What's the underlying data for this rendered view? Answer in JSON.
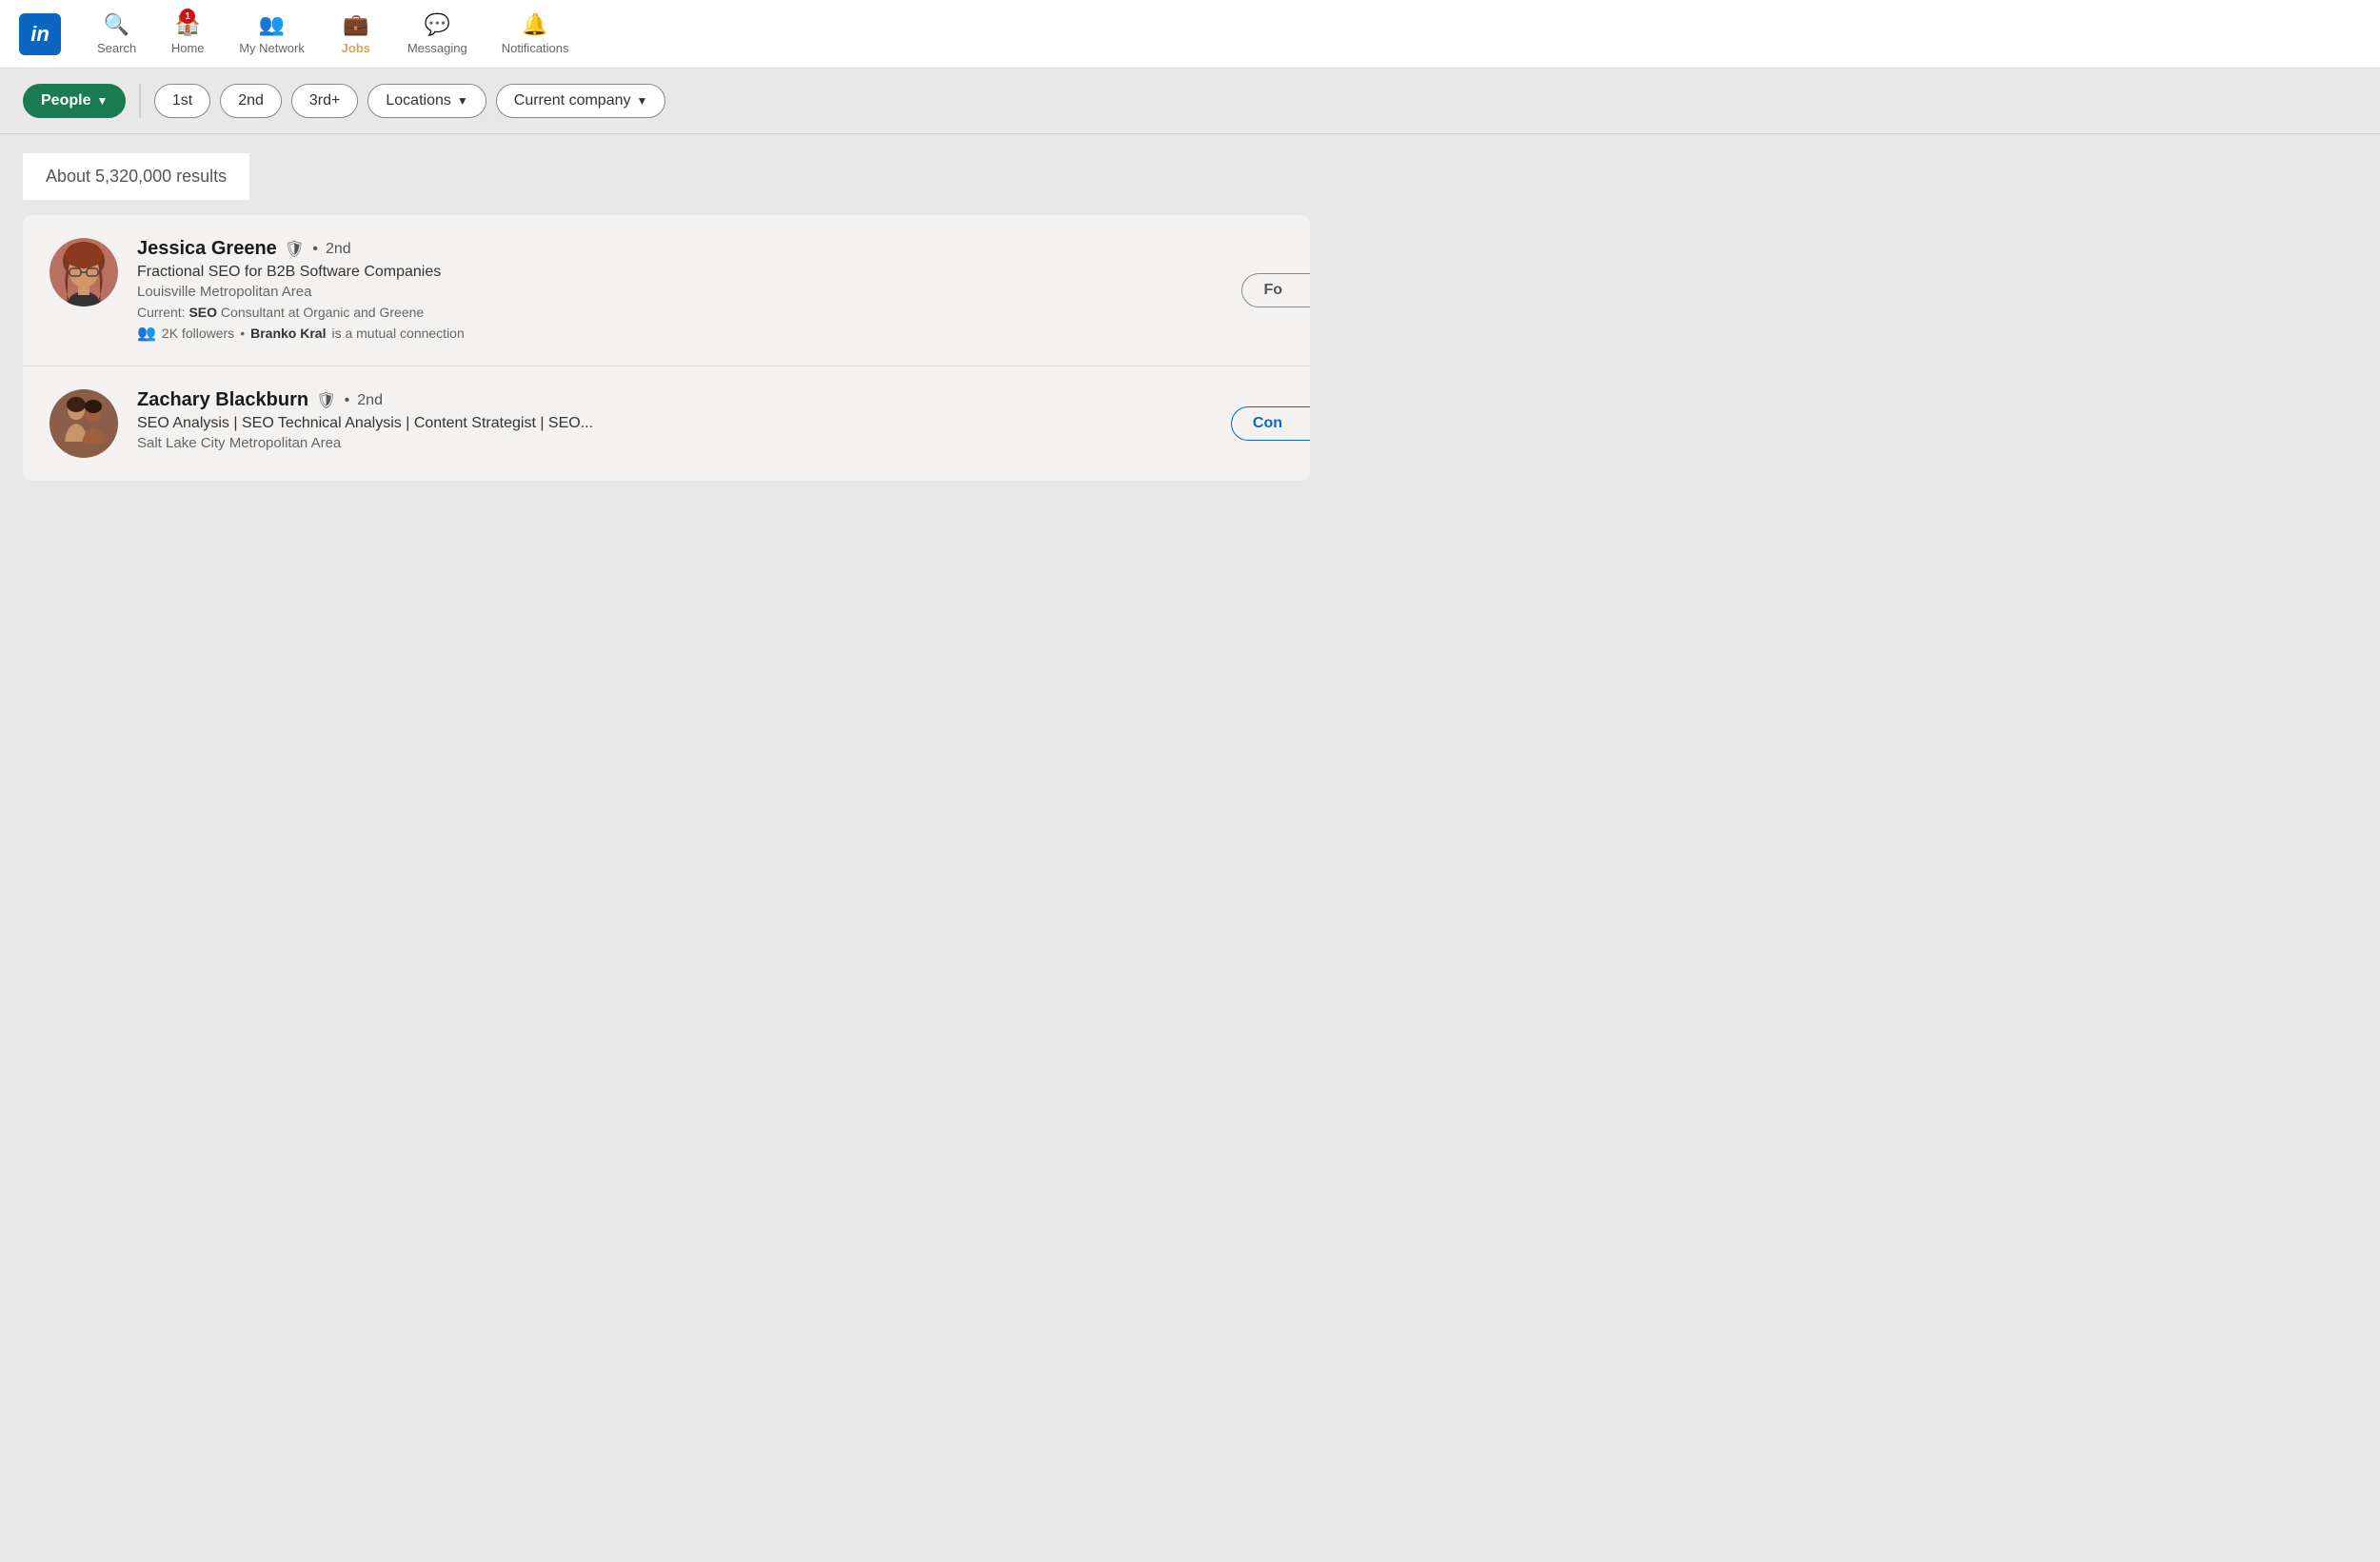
{
  "app": {
    "logo_text": "in"
  },
  "nav": {
    "items": [
      {
        "id": "search",
        "label": "Search",
        "icon": "🔍",
        "active": false,
        "badge": null
      },
      {
        "id": "home",
        "label": "Home",
        "icon": "🏠",
        "active": false,
        "badge": "1"
      },
      {
        "id": "my-network",
        "label": "My Network",
        "icon": "👥",
        "active": false,
        "badge": null
      },
      {
        "id": "jobs",
        "label": "Jobs",
        "icon": "💼",
        "active": true,
        "badge": null
      },
      {
        "id": "messaging",
        "label": "Messaging",
        "icon": "💬",
        "active": false,
        "badge": null
      },
      {
        "id": "notifications",
        "label": "Notifications",
        "icon": "🔔",
        "active": false,
        "badge": null
      }
    ]
  },
  "filters": {
    "people_label": "People",
    "chevron": "▼",
    "connection_filters": [
      {
        "id": "1st",
        "label": "1st"
      },
      {
        "id": "2nd",
        "label": "2nd"
      },
      {
        "id": "3rd",
        "label": "3rd+"
      }
    ],
    "locations_label": "Locations",
    "current_company_label": "Current company"
  },
  "results": {
    "count_text": "About 5,320,000 results",
    "items": [
      {
        "id": "jessica-greene",
        "name": "Jessica Greene",
        "degree": "2nd",
        "headline": "Fractional SEO for B2B Software Companies",
        "location": "Louisville Metropolitan Area",
        "current": "SEO",
        "current_rest": " Consultant at Organic and Greene",
        "followers": "2K followers",
        "mutual_name": "Branko Kral",
        "mutual_rest": " is a mutual connection",
        "action_label": "Fo",
        "action_partial": true
      },
      {
        "id": "zachary-blackburn",
        "name": "Zachary Blackburn",
        "degree": "2nd",
        "headline": "SEO Analysis | SEO Technical Analysis | Content Strategist | SEO...",
        "location": "Salt Lake City Metropolitan Area",
        "current": "",
        "current_rest": "",
        "followers": "",
        "mutual_name": "",
        "mutual_rest": "",
        "action_label": "Con",
        "action_partial": true
      }
    ]
  }
}
